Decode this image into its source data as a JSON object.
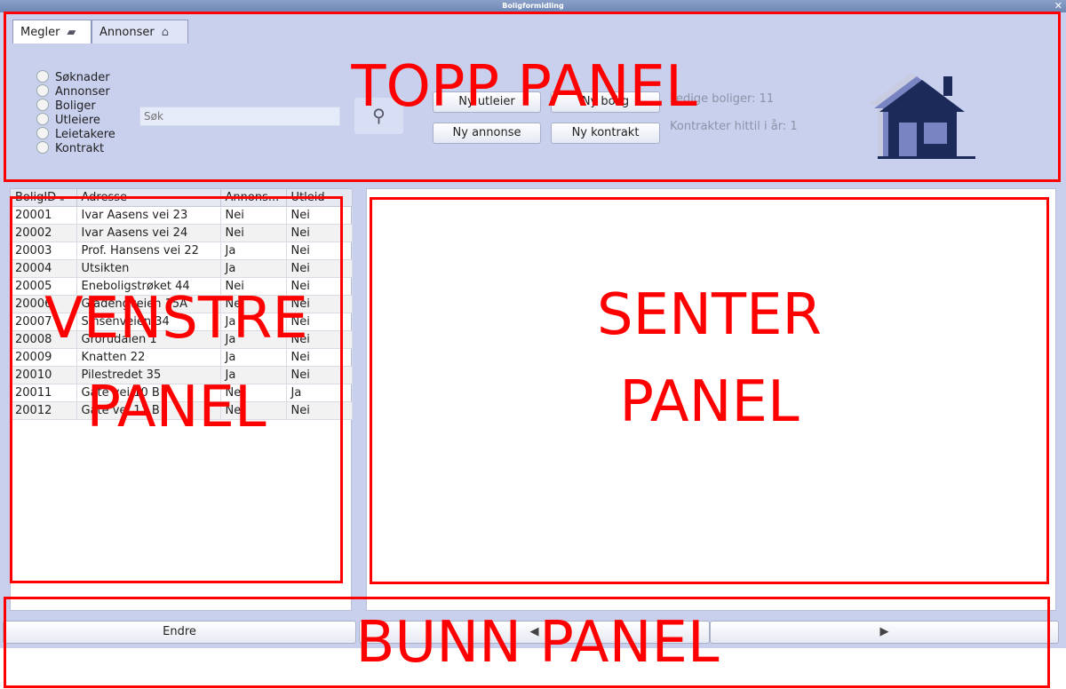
{
  "window": {
    "title": "Boligformidling",
    "close_glyph": "✕"
  },
  "tabs": [
    {
      "label": "Megler",
      "icon": "folder-icon",
      "active": true
    },
    {
      "label": "Annonser",
      "icon": "house-icon",
      "active": false
    }
  ],
  "radios": [
    "Søknader",
    "Annonser",
    "Boliger",
    "Utleiere",
    "Leietakere",
    "Kontrakt"
  ],
  "search": {
    "placeholder": "Søk",
    "icon": "magnifier-icon"
  },
  "buttons": {
    "ny_utleier": "Ny utleier",
    "ny_bolig": "Ny bolig",
    "ny_annonse": "Ny annonse",
    "ny_kontrakt": "Ny kontrakt"
  },
  "stats": {
    "ledige": "Ledige boliger: 11",
    "kontrakter": "Kontrakter hittil i år: 1"
  },
  "table": {
    "columns": [
      "BoligID",
      "Adresse",
      "Annons...",
      "Utleid"
    ],
    "sort_indicator": "▴",
    "rows": [
      [
        "20001",
        "Ivar Aasens vei 23",
        "Nei",
        "Nei"
      ],
      [
        "20002",
        "Ivar Aasens vei 24",
        "Nei",
        "Nei"
      ],
      [
        "20003",
        "Prof. Hansens vei 22",
        "Ja",
        "Nei"
      ],
      [
        "20004",
        "Utsikten",
        "Ja",
        "Nei"
      ],
      [
        "20005",
        "Eneboligstrøket 44",
        "Nei",
        "Nei"
      ],
      [
        "20006",
        "Gladengveien 15A",
        "Nei",
        "Nei"
      ],
      [
        "20007",
        "Sinsenveien 34",
        "Ja",
        "Nei"
      ],
      [
        "20008",
        "Grorudalen 1",
        "Ja",
        "Nei"
      ],
      [
        "20009",
        "Knatten 22",
        "Ja",
        "Nei"
      ],
      [
        "20010",
        "Pilestredet 35",
        "Ja",
        "Nei"
      ],
      [
        "20011",
        "Gate vei 10 B",
        "Nei",
        "Ja"
      ],
      [
        "20012",
        "Gate vei 11 B",
        "Nei",
        "Nei"
      ]
    ]
  },
  "bottom": {
    "endre": "Endre",
    "prev_glyph": "◀",
    "next_glyph": "▶"
  },
  "annotations": {
    "topp": "TOPP PANEL",
    "venstre_1": "VENSTRE",
    "venstre_2": "PANEL",
    "senter_1": "SENTER",
    "senter_2": "PANEL",
    "bunn": "BUNN PANEL"
  },
  "colors": {
    "app_bg": "#c8d0ee",
    "annotation": "#ff0000",
    "house_dark": "#1c2a5a"
  }
}
